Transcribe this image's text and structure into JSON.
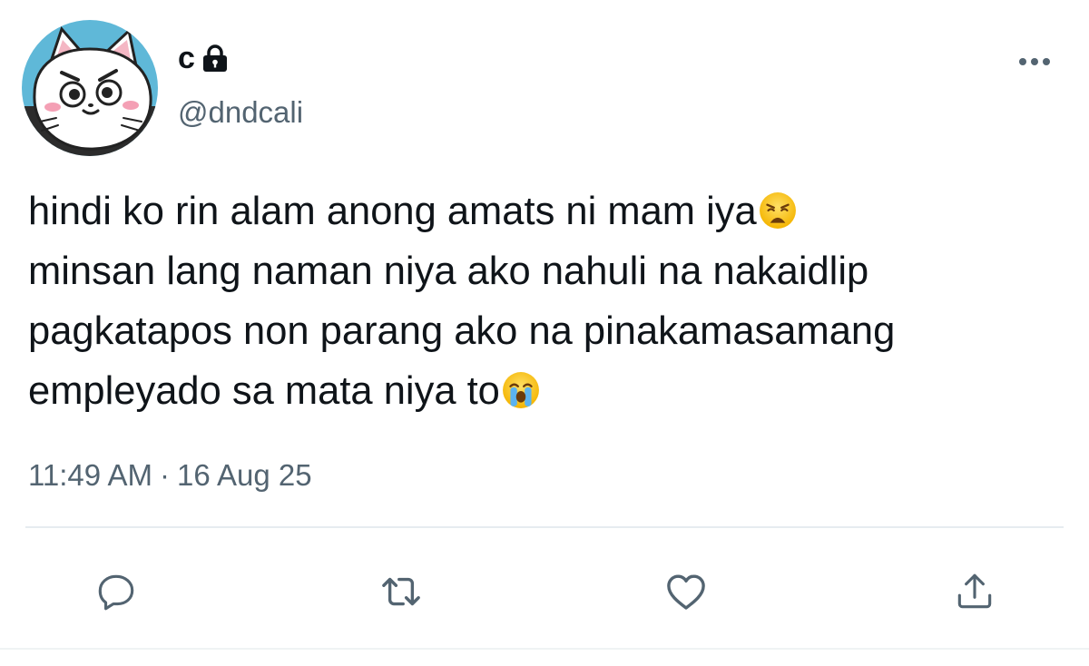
{
  "author": {
    "display_name": "c",
    "handle": "@dndcali",
    "avatar_icon": "cat-avatar",
    "protected_icon": "lock-icon"
  },
  "tweet": {
    "lines": [
      "hindi ko rin alam anong amats ni mam iya",
      "minsan lang naman niya ako nahuli na nakaidlip",
      "pagkatapos non parang ako na pinakamasamang",
      "empleyado sa mata niya to"
    ],
    "emojis": [
      "weary-face-emoji",
      "loudly-crying-face-emoji"
    ]
  },
  "meta": {
    "time": "11:49 AM",
    "separator": "·",
    "date": "16 Aug 25"
  },
  "actions": [
    "reply-icon",
    "retweet-icon",
    "like-icon",
    "share-icon"
  ],
  "colors": {
    "text": "#0f1419",
    "secondary": "#536471",
    "divider": "#e6ecf0",
    "avatar_bg": "#5fb8d8"
  }
}
